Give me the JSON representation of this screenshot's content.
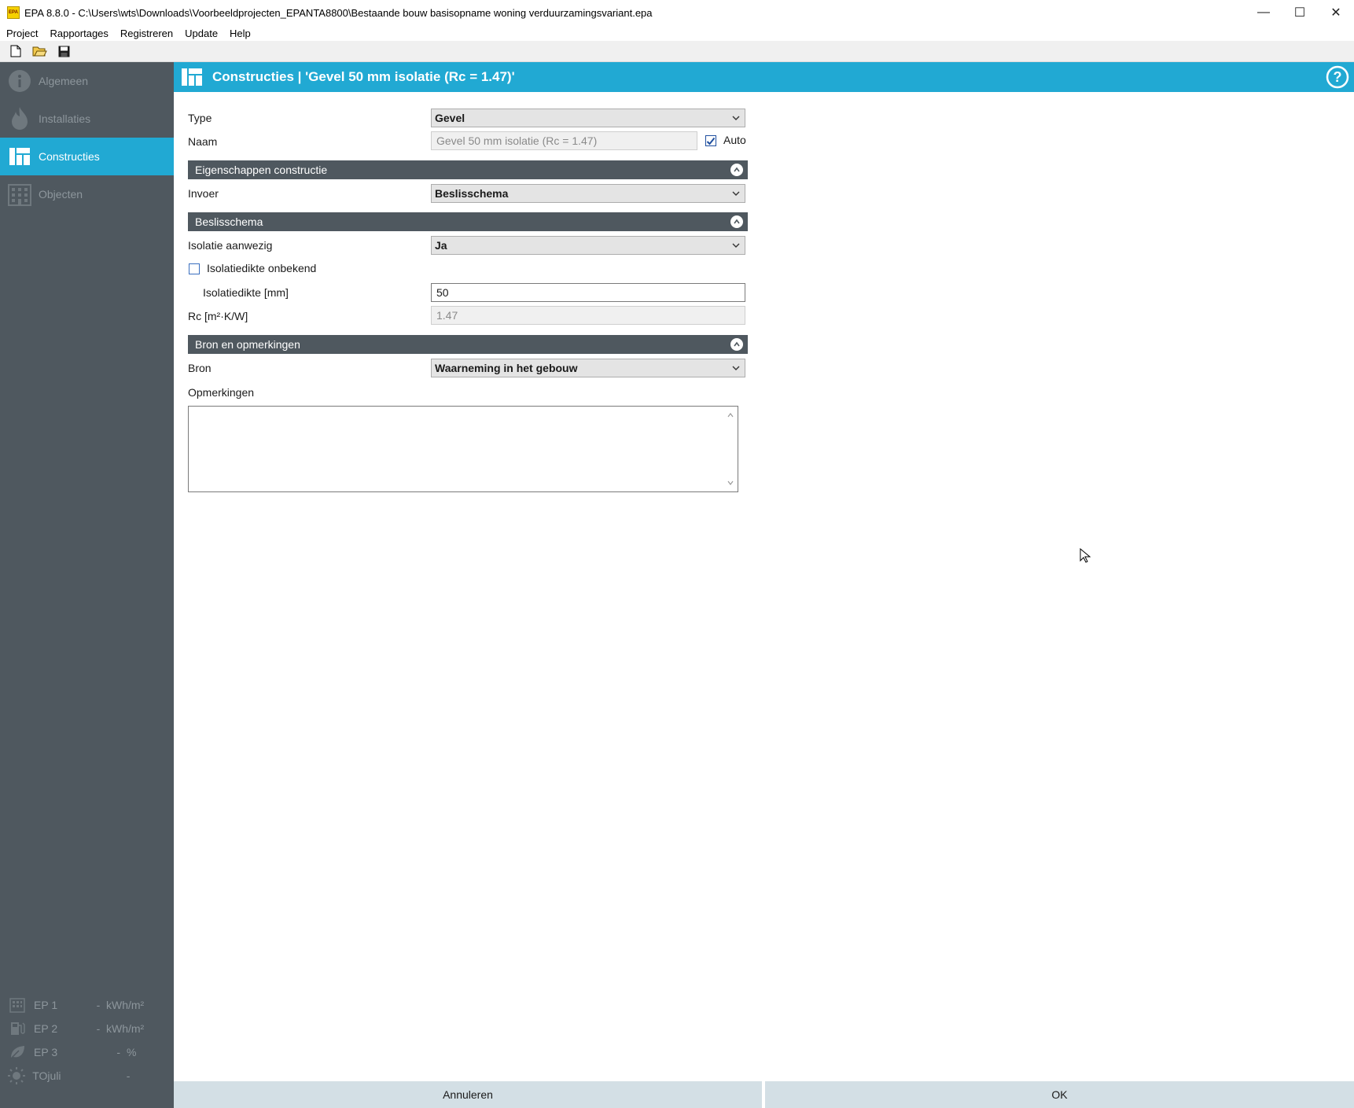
{
  "window": {
    "logo_text": "EPA",
    "title": "EPA 8.8.0 - C:\\Users\\wts\\Downloads\\Voorbeeldprojecten_EPANTA8800\\Bestaande bouw basisopname woning verduurzamingsvariant.epa",
    "minimize": "—",
    "maximize": "☐",
    "close": "✕"
  },
  "menu": [
    "Project",
    "Rapportages",
    "Registreren",
    "Update",
    "Help"
  ],
  "toolbar": {
    "icons": [
      "new-file-icon",
      "open-folder-icon",
      "save-icon"
    ]
  },
  "sidebar": {
    "items": [
      {
        "label": "Algemeen",
        "icon": "info-icon",
        "active": false
      },
      {
        "label": "Installaties",
        "icon": "flame-icon",
        "active": false
      },
      {
        "label": "Constructies",
        "icon": "layout-icon",
        "active": true
      },
      {
        "label": "Objecten",
        "icon": "building-icon",
        "active": false
      }
    ],
    "ep": [
      {
        "label": "EP 1",
        "value": "-",
        "unit": "kWh/m²",
        "icon": "building-icon"
      },
      {
        "label": "EP 2",
        "value": "-",
        "unit": "kWh/m²",
        "icon": "fuel-pump-icon"
      },
      {
        "label": "EP 3",
        "value": "-",
        "unit": "%",
        "icon": "leaf-icon"
      },
      {
        "label": "TOjuli",
        "value": "-",
        "unit": "",
        "icon": "sun-icon"
      }
    ]
  },
  "header": {
    "title": "Constructies | 'Gevel 50 mm isolatie (Rc = 1.47)'"
  },
  "form": {
    "type_label": "Type",
    "type_value": "Gevel",
    "naam_label": "Naam",
    "naam_value": "Gevel 50 mm isolatie (Rc = 1.47)",
    "auto_label": "Auto",
    "auto_checked": true,
    "section_eigenschappen": "Eigenschappen constructie",
    "invoer_label": "Invoer",
    "invoer_value": "Beslisschema",
    "section_beslisschema": "Beslisschema",
    "isolatie_label": "Isolatie aanwezig",
    "isolatie_value": "Ja",
    "onbekend_label": "Isolatiedikte onbekend",
    "onbekend_checked": false,
    "dikte_label": "Isolatiedikte [mm]",
    "dikte_value": "50",
    "rc_label": "Rc [m²·K/W]",
    "rc_value": "1.47",
    "section_bron": "Bron en opmerkingen",
    "bron_label": "Bron",
    "bron_value": "Waarneming in het gebouw",
    "opmerkingen_label": "Opmerkingen",
    "opmerkingen_value": ""
  },
  "buttons": {
    "cancel": "Annuleren",
    "ok": "OK"
  },
  "colors": {
    "accent": "#21a9d3",
    "sidebar": "#4f585f",
    "footer": "#d3dfe5"
  }
}
